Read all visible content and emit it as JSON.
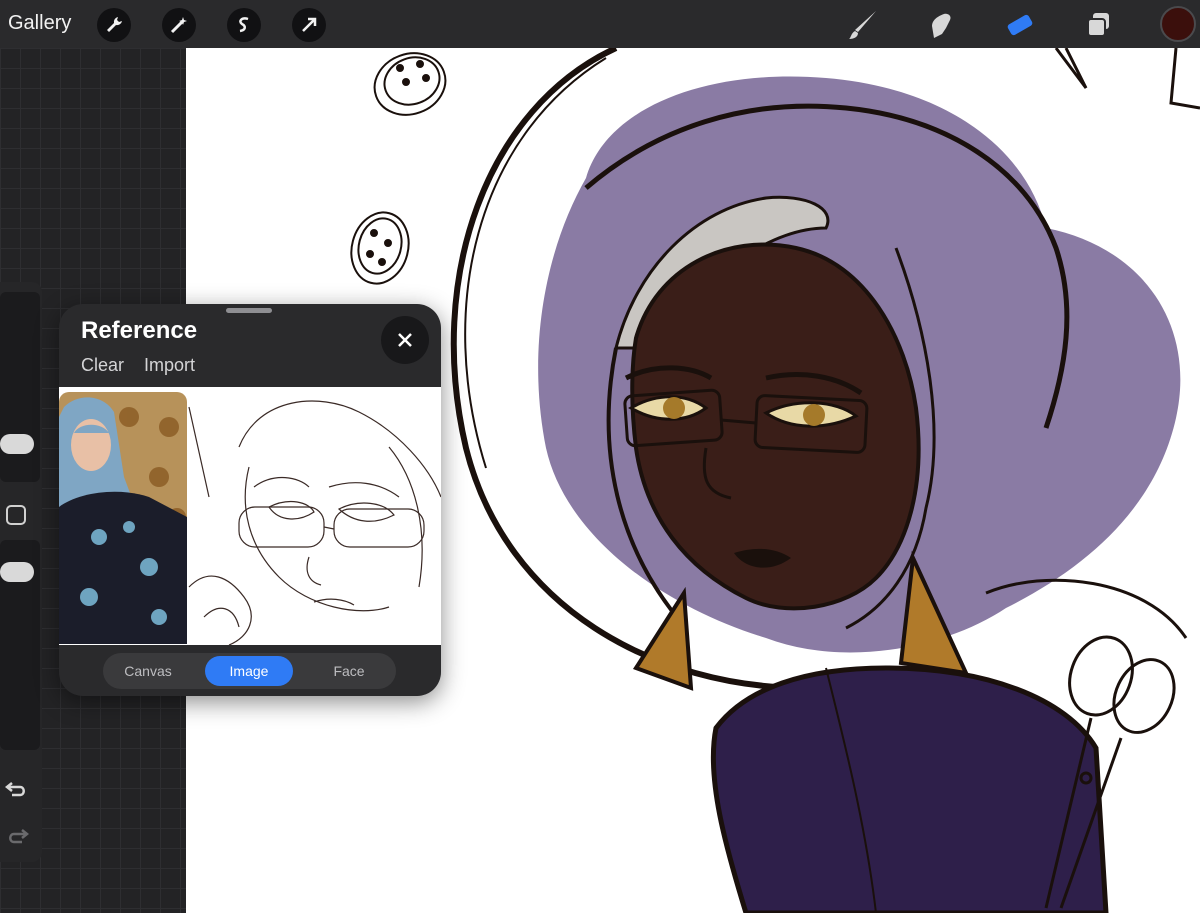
{
  "toolbar": {
    "gallery_label": "Gallery",
    "left_icons": [
      "wrench-icon",
      "magic-wand-icon",
      "selection-icon",
      "transform-arrow-icon"
    ],
    "right_icons": [
      "brush-icon",
      "smudge-icon",
      "eraser-icon",
      "layers-icon"
    ],
    "active_tool": "eraser",
    "current_color": "#3b0f0c",
    "accent_color": "#2f7bf5"
  },
  "reference_panel": {
    "title": "Reference",
    "clear_label": "Clear",
    "import_label": "Import",
    "tabs": [
      {
        "label": "Canvas",
        "active": false
      },
      {
        "label": "Image",
        "active": true
      },
      {
        "label": "Face",
        "active": false
      }
    ]
  },
  "sidebar": {
    "icons": [
      "modify-square-icon",
      "undo-icon",
      "redo-icon"
    ]
  },
  "canvas_colors": {
    "hijab_purple": "#8a7ba4",
    "skin_brown": "#3a1e18",
    "earring_gold": "#b07a2a",
    "shirt_dark_purple": "#2e1f4a",
    "lineart": "#1a100c"
  }
}
